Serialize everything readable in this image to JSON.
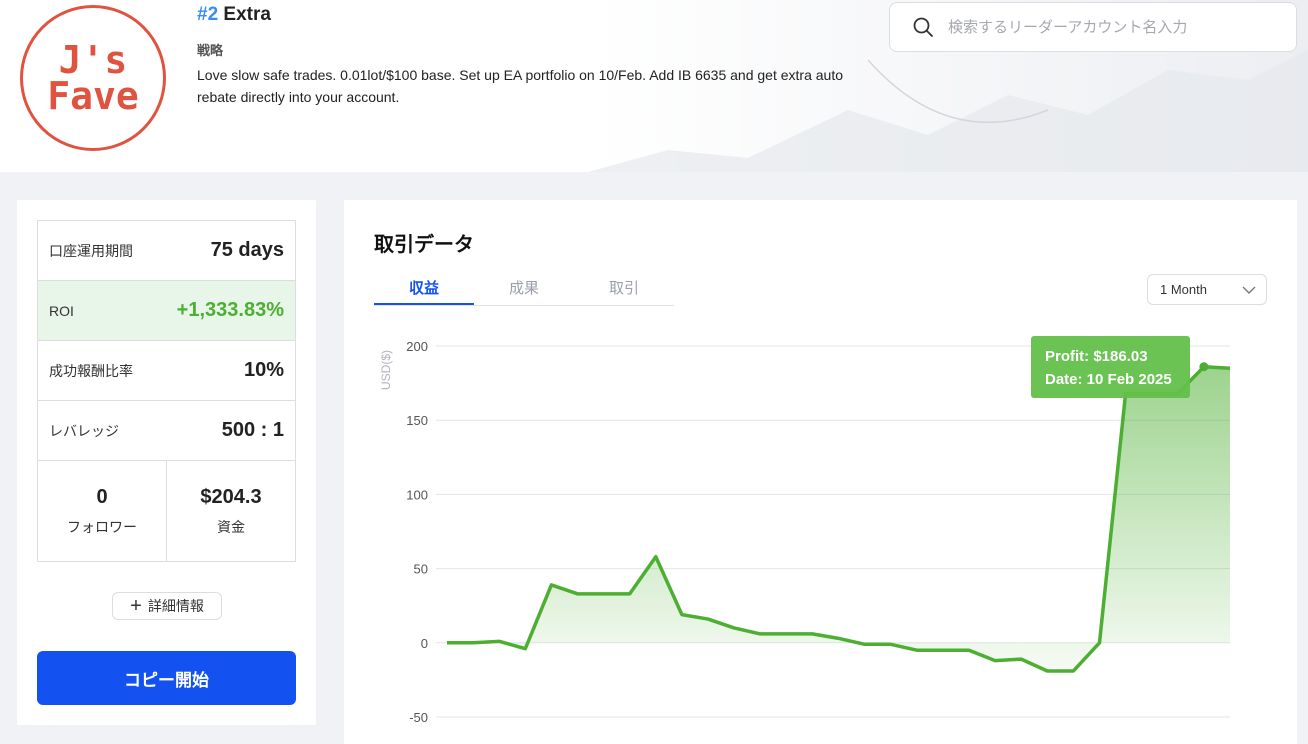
{
  "header": {
    "rank": "#2",
    "name": "Extra",
    "strategy_label": "戦略",
    "strategy_text": "Love slow safe trades. 0.01lot/$100 base. Set up EA portfolio on 10/Feb. Add IB 6635 and get extra auto rebate directly into your account.",
    "logo_line1": "J's",
    "logo_line2": "Fave",
    "logo_color": "#e0533f"
  },
  "search": {
    "placeholder": "検索するリーダーアカウント名入力"
  },
  "stats": {
    "period_label": "口座運用期間",
    "period_value": "75 days",
    "roi_label": "ROI",
    "roi_value": "+1,333.83%",
    "fee_label": "成功報酬比率",
    "fee_value": "10%",
    "leverage_label": "レバレッジ",
    "leverage_value": "500 : 1",
    "followers_value": "0",
    "followers_label": "フォロワー",
    "funds_value": "$204.3",
    "funds_label": "資金"
  },
  "buttons": {
    "detail": "詳細情報",
    "copy": "コピー開始"
  },
  "colors": {
    "accent": "#1352f0",
    "profit": "#4caf31",
    "rank": "#3b8cf0"
  },
  "trade_section": {
    "title": "取引データ",
    "tabs": [
      "収益",
      "成果",
      "取引"
    ],
    "active_tab": 0,
    "period_select": "1 Month"
  },
  "chart_data": {
    "type": "area",
    "ylabel": "USD($)",
    "ylim": [
      -50,
      200
    ],
    "yticks": [
      200,
      150,
      100,
      50,
      0,
      -50
    ],
    "grid": true,
    "series": [
      {
        "values": [
          0,
          0,
          1,
          -4,
          39,
          33,
          33,
          33,
          58,
          19,
          16,
          10,
          6,
          6,
          6,
          3,
          -1,
          -1,
          -5,
          -5,
          -5,
          -12,
          -11,
          -19,
          -19,
          0,
          168,
          168,
          168,
          186.03,
          185
        ]
      }
    ],
    "tooltip": {
      "profit": "Profit: $186.03",
      "date": "Date: 10 Feb 2025",
      "point_index": 29
    }
  }
}
